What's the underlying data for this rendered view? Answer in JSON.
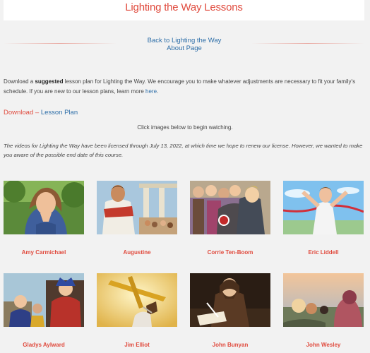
{
  "page": {
    "title": "Lighting the Way Lessons",
    "back_line1": "Back to Lighting the Way",
    "back_line2": "About Page"
  },
  "intro": {
    "before_bold": "Download a ",
    "bold": "suggested",
    "after_bold": " lesson plan for Lighting the Way. We encourage you to make whatever adjustments are necessary to fit your family's schedule. If you are new to our lesson plans, learn more ",
    "link": "here",
    "end": "."
  },
  "download": {
    "label": "Download",
    "sep": " – ",
    "link": "Lesson Plan"
  },
  "instruction": "Click images below to begin watching.",
  "license_note": "The videos for Lighting the Way have been licensed through July 13, 2022, at which time we hope to renew our license. However, we wanted to make you aware of the possible end date of this course.",
  "lessons": [
    {
      "name": "Amy Carmichael"
    },
    {
      "name": "Augustine"
    },
    {
      "name": "Corrie Ten-Boom"
    },
    {
      "name": "Eric Liddell"
    },
    {
      "name": "Gladys Aylward"
    },
    {
      "name": "Jim Elliot"
    },
    {
      "name": "John Bunyan"
    },
    {
      "name": "John Wesley"
    }
  ],
  "colors": {
    "accent": "#e04b3e",
    "link": "#2d6ea8",
    "background": "#f2f2f2"
  }
}
